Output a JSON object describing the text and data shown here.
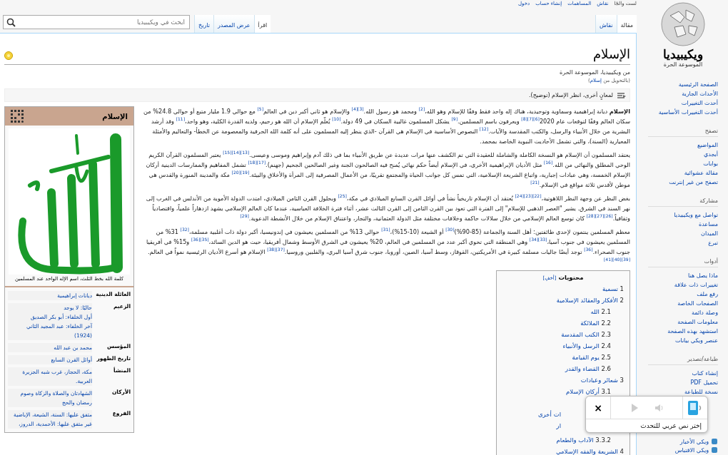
{
  "personal_links": [
    "لست والجًا",
    "نقاش",
    "المساهمات",
    "إنشاء حساب",
    "دخول"
  ],
  "site": {
    "name": "ويكيبيديا",
    "tagline": "الموسوعة الحرة"
  },
  "namespace_tabs": [
    {
      "label": "مقالة",
      "selected": true
    },
    {
      "label": "نقاش",
      "selected": false
    }
  ],
  "view_tabs": [
    {
      "label": "اقرأ",
      "selected": true
    },
    {
      "label": "عرض المصدر",
      "selected": false
    },
    {
      "label": "تاريخ",
      "selected": false
    }
  ],
  "search": {
    "placeholder": "ابحث في ويكيبيديا"
  },
  "sidebar": [
    {
      "items": [
        "الصفحة الرئيسية",
        "الأحداث الجارية",
        "أحدث التغييرات",
        "أحدث التغييرات الأساسية"
      ]
    },
    {
      "heading": "تصفح",
      "items": [
        "المواضيع",
        "أبجدي",
        "بوابات",
        "مقالة عشوائية",
        "تصفح من غير إنترنت"
      ]
    },
    {
      "heading": "مشاركة",
      "items": [
        "تواصل مع ويكيبيديا",
        "مساعدة",
        "الميدان",
        "تبرع"
      ]
    },
    {
      "heading": "أدوات",
      "items": [
        "ماذا يصل هنا",
        "تغييرات ذات علاقة",
        "رفع ملف",
        "الصفحات الخاصة",
        "وصلة دائمة",
        "معلومات الصفحة",
        "استشهد بهذه الصفحة",
        "عنصر ويكي بيانات"
      ]
    },
    {
      "heading": "طباعة/تصدير",
      "items": [
        "إنشاء كتاب",
        "تحميل PDF",
        "نسخة للطباعة"
      ]
    }
  ],
  "other_projects": [
    "ويكي الأخبار",
    "ويكي الاقتباس"
  ],
  "article": {
    "title": "الإسلام",
    "featured": true,
    "tagline": "من ويكيبيديا، الموسوعة الحرة",
    "redirect": {
      "before": "(بالتحويل من ",
      "link": "إسلام",
      "after": ")"
    },
    "hatnote": "لمعانٍ أخرى، انظر الإسلام (توضيح).",
    "paragraphs": [
      "**الإسلام** ديانة إبراهيمية وسماوية وتوحيدية، هناك إله واحد فقط وفقًا للإسلام وهو الله،$^{[2]}$ ومحمد هو رسول الله.$^{[3][4]}$ والإسلام هو ثاني أكبر دين في العالم$^{[5]}$ مع حوالي 1.9 مليار متبع أو حوالي 24.8% من سكان العالم وفقًا لتوقعات عام 2020$^{[6][7][8]}$ ويعرفون باسم المسلمين.$^{[9]}$ يشكل المسلمون غالبية السكان في 49 دولة.$^{[10]}$ يُعلّم الإسلام أن الله هو رحيم، ولديه القدرة الكلية، وهو واحد،$^{[11]}$ وقد أرشد البشرية من خلال الأنبياء والرسل، والكتب المقدسة والآيات.$^{[12]}$ النصوص الأساسية في الإسلام هي القرآن -الذي ينظر إليه المسلمون على أنه كلمة الله الحرفية والمعصومة عن الخطأ- والتعاليم والأمثلة المعيارية (السنة)، والتي تشمل الأحاديث النبوية الخاصة بمحمد.",
      "يعتقد المسلمون أن الإسلام هو النسخة الكاملة والشاملة للعقيدة التي تم الكشف عنها مرات عديدة عن طريق الأنبياء بما في ذلك آدم وإبراهيم وموسى وعيسى.$^{[13][14][15]}$ يعتبر المسلمون القرآن الكريم الوحي المطلق والنهائي من الله.$^{[16]}$ مثل الأديان الإبراهيمية الأخرى، في الإسلام أيضاً حكم نهائي يُمنح فيه الصالحون الجنة وغير الصالحين الجحيم (جهنم).$^{[17][18]}$ تشمل المفاهيم والممارسات الدينية أركان الإسلام الخمسة، وهي عبادات إجبارية، واتباع الشريعة الإسلامية، التي تمس كل جوانب الحياة والمجتمع تقريبًا، من الأعمال المصرفية إلى المرأة والأخلاق والبيئة.$^{[19][20]}$ مكة والمدينة المنورة والقدس هي موطن لأقدس ثلاثة مواقع في الإسلام.$^{[21]}$",
      "بغض النظر عن وجهة النظر اللاهوتية،$^{[22][23][24]}$ يُعتقد أن الإسلام تاريخياً نشأ في أوائل القرن السابع الميلادي في مكة،$^{[25]}$ وبحلول القرن الثامن الميلادي، امتدت الدولة الأموية من الأندلس في الغرب إلى نهر السند في الشرق. يشير \"العصر الذهبي للإسلام\" إلى الفترة التي تعود بين القرن الثامن إلى القرن الثالث عشر، أثناء فترة الخلافة العباسية، عندما كان العالم الإسلامي يشهد ازدهاراً علمياً، واقتصادياً وثقافياً.$^{[26][27][28]}$ كان توسع العالم الإسلامي من خلال سلالات حاكمة وخلافات مختلفة مثل الدولة العثمانية، والتجار، واعتناق الإسلام من خلال الأنشطة الدعوية.$^{[29]}$",
      "معظم المسلمين ينتمون لإحدى طائفتين: أهل السنة والجماعة (85-90%)$^{[30]}$ أو الشيعة (10-15%)،$^{[31]}$ حوالي 13% من المسلمين يعيشون في إندونيسيا، أكبر دولة ذات أغلبية مسلمة،$^{[32]}$ 31% من المسلمين يعيشون في جنوب آسيا،$^{[33][34]}$ وهي المنطقة التي تحوي أكبر عدد من المسلمين في العالم، 20% يعيشون في الشرق الأوسط وشمال أفريقيا، حيث هو الدين السائد،$^{[35][36]}$ و15% في أفريقيا جنوب الصحراء.$^{[36]}$ توجد أيضًا جاليات مسلمة كبيرة في الأمريكتين، القوقاز، وسط آسيا، الصين، أوروبا، جنوب شرق آسيا البري، والفلبين وروسيا.$^{[37][38]}$ الإسلام هو أسرع الأديان الرئيسية نمواً في العالم.$^{[39][40][41]}$"
    ],
    "infobox": {
      "title": "الإسلام",
      "caption": "كلمة الله بخط الثلث، اسم الإله الواحد عند المسلمين",
      "rows": [
        {
          "label": "العائلة الدينية",
          "lines": [
            "ديانات إبراهيمية"
          ]
        },
        {
          "label": "الزعيم",
          "lines": [
            "حاليًا: لا يوجد",
            "أول الخلفاء: أبو بكر الصديق",
            "آخر الخلفاء: عبد المجيد الثاني",
            "(1924)"
          ]
        },
        {
          "label": "المؤسس",
          "lines": [
            "محمد بن عبد الله"
          ]
        },
        {
          "label": "تاريخ الظهور",
          "lines": [
            "أوائل القرن السابع"
          ]
        },
        {
          "label": "المنشأ",
          "lines": [
            "مكة، الحجاز، غرب شبه الجزيرة العربية."
          ]
        },
        {
          "label": "الأركان",
          "lines": [
            "الشهادتان والصلاة والزكاة وصوم رمضان والحج"
          ]
        },
        {
          "label": "الفروع",
          "lines": [
            "متفق عليها: السنة، الشيعة، الإباضية",
            "غير متفق عليها: الأحمدية، الدروز،"
          ]
        }
      ]
    },
    "toc": {
      "title": "محتويات",
      "toggle": "[أخفِ]",
      "items": [
        {
          "number": "1",
          "title": "تسمية"
        },
        {
          "number": "2",
          "title": "الأفكار والعقائد الإسلامية",
          "children": [
            {
              "number": "2.1",
              "title": "الله"
            },
            {
              "number": "2.2",
              "title": "الملائكة"
            },
            {
              "number": "2.3",
              "title": "الكتب المقدسة"
            },
            {
              "number": "2.4",
              "title": "الرسل والأنبياء"
            },
            {
              "number": "2.5",
              "title": "يوم القيامة"
            },
            {
              "number": "2.6",
              "title": "القضاء والقدر"
            }
          ]
        },
        {
          "number": "3",
          "title": "شعائر وعبادات",
          "children": [
            {
              "number": "3.1",
              "title": "أركان الإسلام"
            },
            {
              "title": "ات أخرى"
            },
            {
              "title": "ار"
            },
            {
              "number": "3.3.2",
              "title": "الآداب والطعام"
            }
          ]
        },
        {
          "number": "4",
          "title": "الشريعة والفقه الإسلامي"
        }
      ]
    }
  },
  "speech_popup": {
    "message": "إختر نص عربي للتحدث",
    "close": "×"
  }
}
